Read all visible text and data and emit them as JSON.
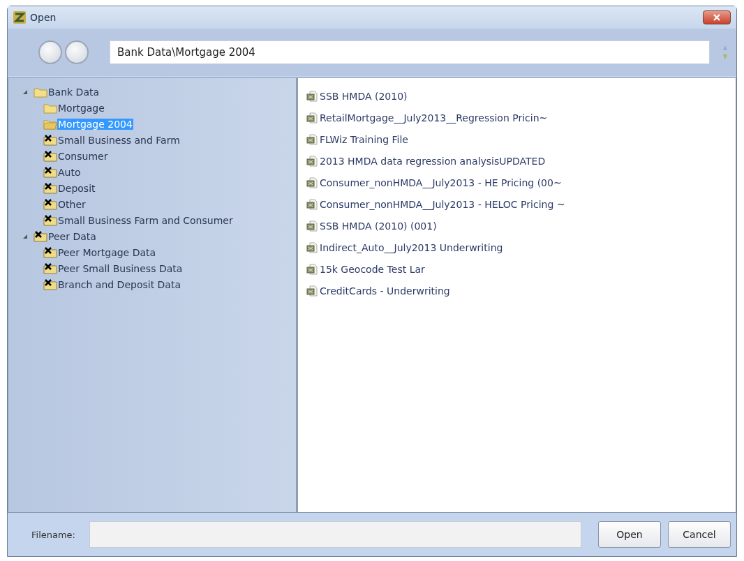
{
  "window": {
    "title": "Open"
  },
  "path": {
    "value": "Bank Data\\Mortgage 2004"
  },
  "tree": [
    {
      "label": "Bank Data",
      "kind": "folder",
      "expanded": true,
      "selected": false,
      "children": [
        {
          "label": "Mortgage",
          "kind": "folder",
          "selected": false
        },
        {
          "label": "Mortgage 2004",
          "kind": "folder",
          "selected": true
        },
        {
          "label": "Small Business and Farm",
          "kind": "excluded",
          "selected": false
        },
        {
          "label": "Consumer",
          "kind": "excluded",
          "selected": false
        },
        {
          "label": "Auto",
          "kind": "excluded",
          "selected": false
        },
        {
          "label": "Deposit",
          "kind": "excluded",
          "selected": false
        },
        {
          "label": "Other",
          "kind": "excluded",
          "selected": false
        },
        {
          "label": "Small Business Farm and Consumer",
          "kind": "excluded",
          "selected": false
        }
      ]
    },
    {
      "label": "Peer Data",
      "kind": "excluded",
      "expanded": true,
      "selected": false,
      "children": [
        {
          "label": "Peer Mortgage Data",
          "kind": "excluded",
          "selected": false
        },
        {
          "label": "Peer Small Business Data",
          "kind": "excluded",
          "selected": false
        },
        {
          "label": "Branch and Deposit Data",
          "kind": "excluded",
          "selected": false
        }
      ]
    }
  ],
  "files": [
    "SSB HMDA (2010)",
    "RetailMortgage__July2013__Regression Pricin~",
    "FLWiz Training File",
    "2013 HMDA data regression analysisUPDATED",
    "Consumer_nonHMDA__July2013 - HE Pricing (00~",
    "Consumer_nonHMDA__July2013 - HELOC Pricing ~",
    "SSB HMDA (2010) (001)",
    "Indirect_Auto__July2013 Underwriting",
    "15k Geocode Test Lar",
    "CreditCards - Underwriting"
  ],
  "filename": {
    "label": "Filename:"
  },
  "buttons": [
    "Open",
    "Cancel"
  ]
}
